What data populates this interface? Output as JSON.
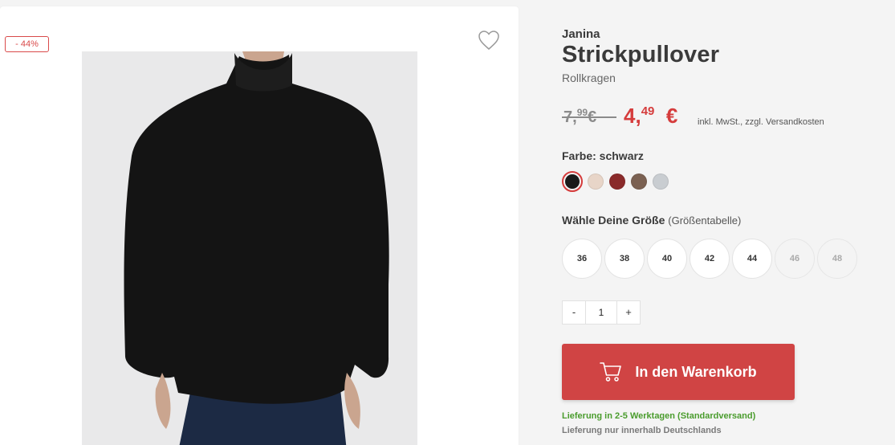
{
  "badge": {
    "discount": "- 44%"
  },
  "product": {
    "brand": "Janina",
    "title": "Strickpullover",
    "subtitle": "Rollkragen"
  },
  "price": {
    "old_main": "7,",
    "old_cents": "99",
    "old_currency": "€",
    "new_main": "4,",
    "new_cents": "49",
    "new_currency": "€",
    "tax_note": "inkl. MwSt., zzgl. Versandkosten"
  },
  "color": {
    "label": "Farbe: schwarz",
    "swatches": [
      {
        "name": "schwarz",
        "hex": "#1a1a1a",
        "selected": true
      },
      {
        "name": "beige",
        "hex": "#e8d5c8",
        "selected": false
      },
      {
        "name": "bordeaux",
        "hex": "#8a2a2a",
        "selected": false
      },
      {
        "name": "braun",
        "hex": "#7b6152",
        "selected": false
      },
      {
        "name": "grau",
        "hex": "#c9cdd1",
        "selected": false
      }
    ]
  },
  "size": {
    "label_bold": "Wähle Deine Größe",
    "chart_link": "(Größentabelle)",
    "options": [
      {
        "label": "36",
        "available": true
      },
      {
        "label": "38",
        "available": true
      },
      {
        "label": "40",
        "available": true
      },
      {
        "label": "42",
        "available": true
      },
      {
        "label": "44",
        "available": true
      },
      {
        "label": "46",
        "available": false
      },
      {
        "label": "48",
        "available": false
      }
    ]
  },
  "quantity": {
    "minus": "-",
    "value": "1",
    "plus": "+"
  },
  "cart": {
    "button_label": "In den Warenkorb",
    "icon": "cart-icon"
  },
  "delivery": {
    "line1": "Lieferung in 2-5 Werktagen (Standardversand)",
    "line2": "Lieferung nur innerhalb Deutschlands"
  },
  "colors": {
    "accent": "#d04444",
    "delivery_green": "#4a9c2d"
  }
}
